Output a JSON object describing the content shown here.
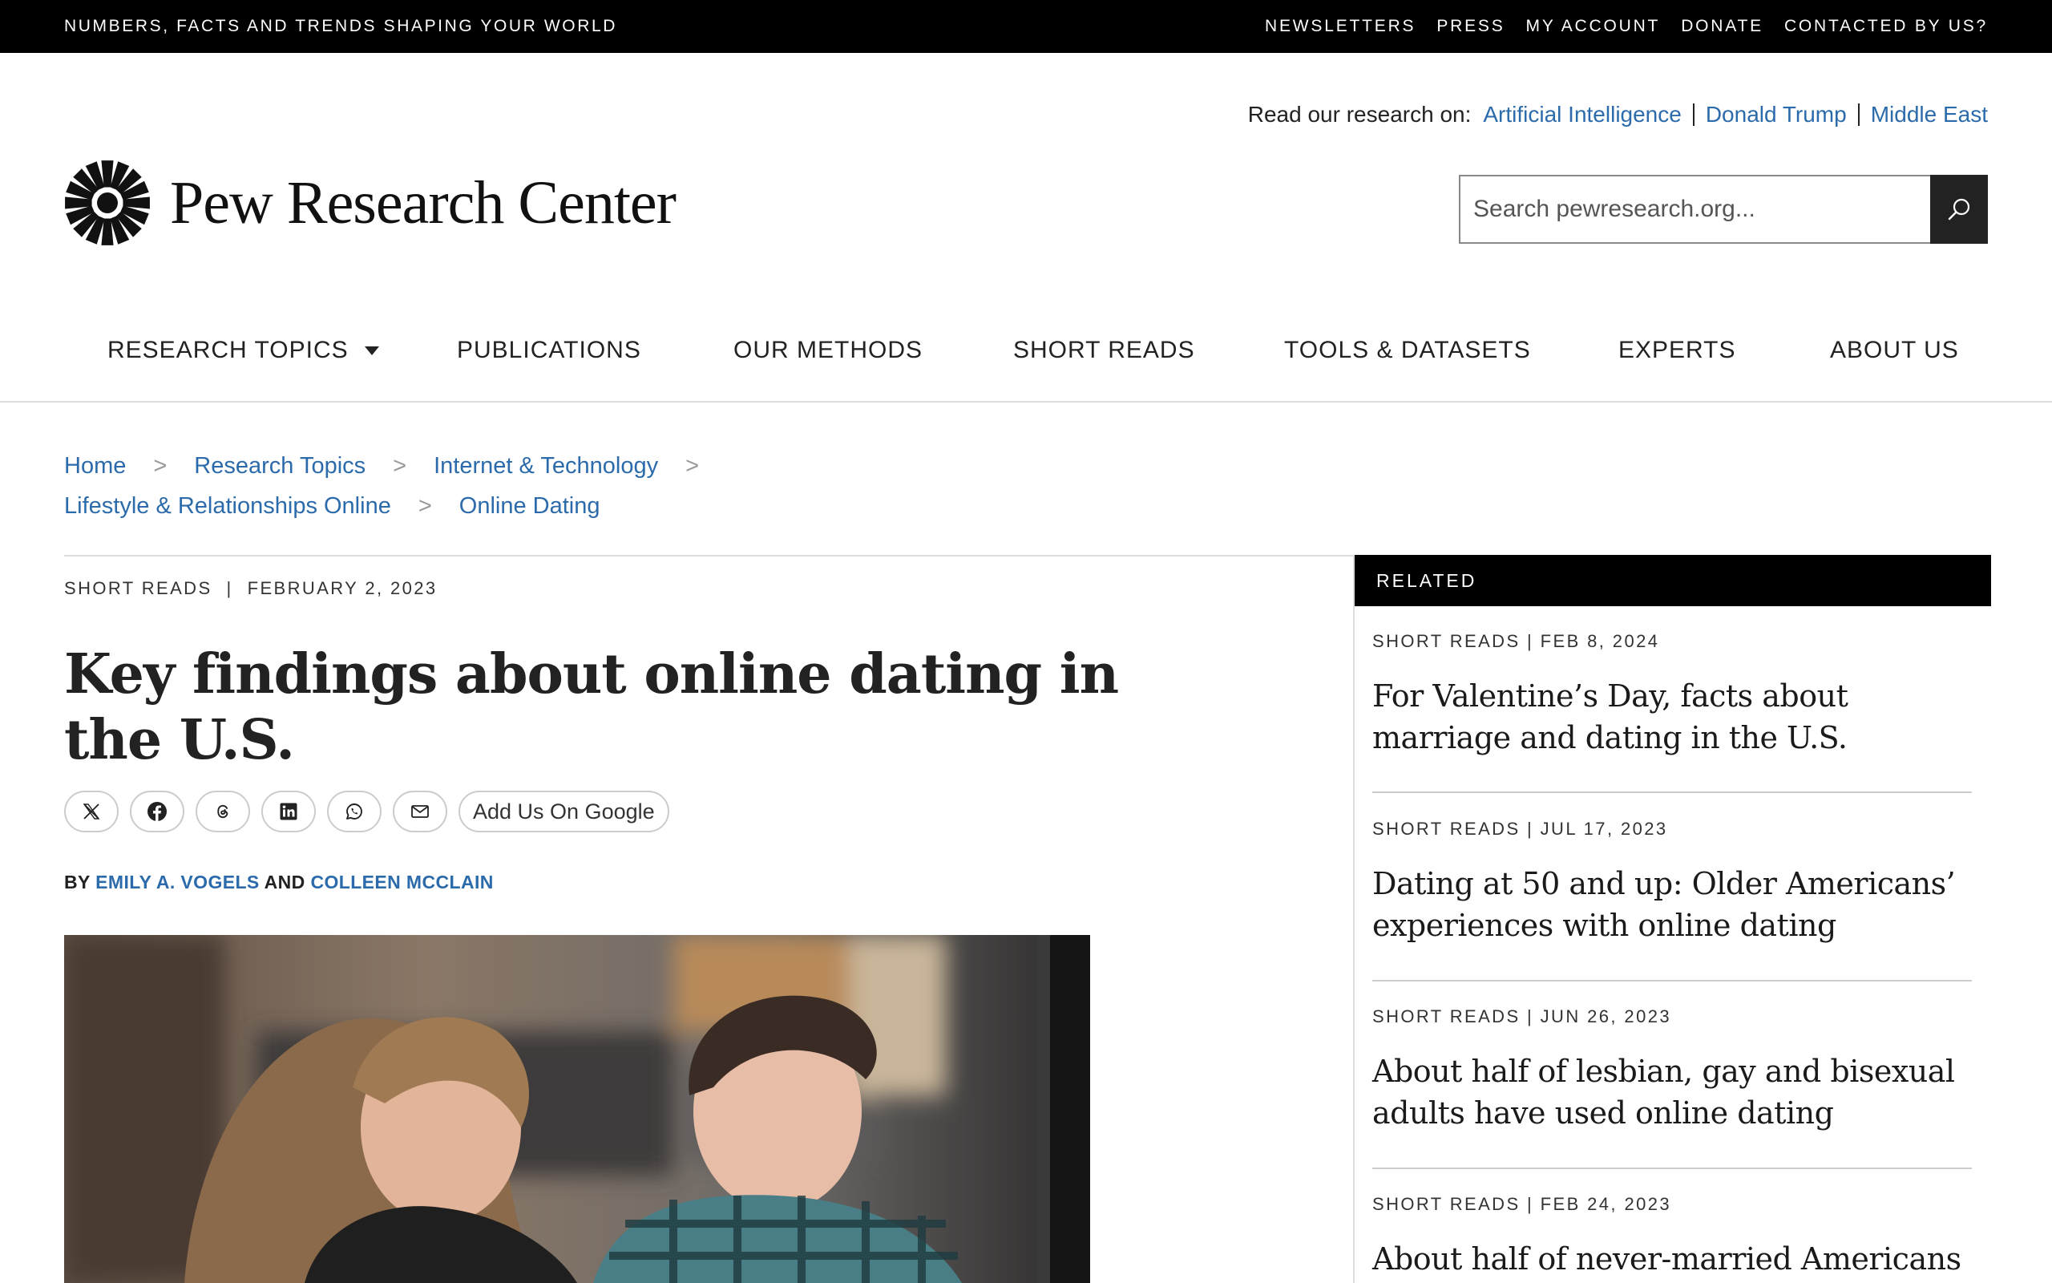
{
  "topbar": {
    "tagline": "NUMBERS, FACTS AND TRENDS SHAPING YOUR WORLD",
    "links": [
      "NEWSLETTERS",
      "PRESS",
      "MY ACCOUNT",
      "DONATE",
      "CONTACTED BY US?"
    ]
  },
  "read_research": {
    "label": "Read our research on:",
    "links": [
      "Artificial Intelligence",
      "Donald Trump",
      "Middle East"
    ]
  },
  "logo": {
    "text": "Pew Research Center"
  },
  "search": {
    "placeholder": "Search pewresearch.org..."
  },
  "nav": {
    "items": [
      "RESEARCH TOPICS",
      "PUBLICATIONS",
      "OUR METHODS",
      "SHORT READS",
      "TOOLS & DATASETS",
      "EXPERTS",
      "ABOUT US"
    ]
  },
  "breadcrumb": {
    "items": [
      "Home",
      "Research Topics",
      "Internet & Technology",
      "Lifestyle & Relationships Online",
      "Online Dating"
    ],
    "separator": ">"
  },
  "article": {
    "category": "SHORT READS",
    "date": "FEBRUARY 2, 2023",
    "title": "Key findings about online dating in the U.S.",
    "share_google": "Add Us On Google",
    "by": "BY",
    "and": "AND",
    "authors": [
      "EMILY A. VOGELS",
      "COLLEEN MCCLAIN"
    ]
  },
  "related": {
    "heading": "RELATED",
    "items": [
      {
        "meta": "SHORT READS | FEB 8, 2024",
        "title": "For Valentine’s Day, facts about marriage and dating in the U.S."
      },
      {
        "meta": "SHORT READS | JUL 17, 2023",
        "title": "Dating at 50 and up: Older Americans’ experiences with online dating"
      },
      {
        "meta": "SHORT READS | JUN 26, 2023",
        "title": "About half of lesbian, gay and bisexual adults have used online dating"
      },
      {
        "meta": "SHORT READS | FEB 24, 2023",
        "title": "About half of never-married Americans"
      }
    ]
  },
  "colors": {
    "link": "#2c6bab",
    "topbar": "#000000",
    "text": "#222222"
  }
}
